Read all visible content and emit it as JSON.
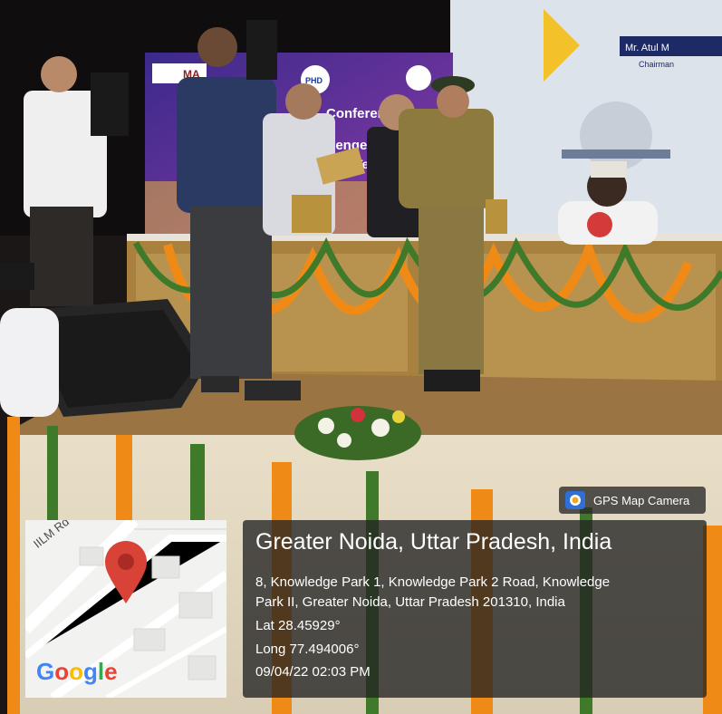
{
  "photo": {
    "backdrop_text_1": "Conference",
    "backdrop_text_2": "llenge",
    "backdrop_text_3": "M",
    "backdrop_text_4": "Tec",
    "backdrop_text_5": "PHD",
    "backdrop_text_6": "MA",
    "screen_name": "Mr. Atul M",
    "screen_role": "Chairman"
  },
  "overlay": {
    "app_badge": "GPS Map Camera",
    "map_road_label": "IILM Rd",
    "map_brand": [
      "G",
      "o",
      "o",
      "g",
      "l",
      "e"
    ],
    "map_brand_colors": [
      "#4285F4",
      "#EA4335",
      "#FBBC05",
      "#4285F4",
      "#34A853",
      "#EA4335"
    ],
    "location_title": "Greater Noida, Uttar Pradesh, India",
    "address_line_1": "8, Knowledge Park 1, Knowledge Park 2 Road, Knowledge",
    "address_line_2": "Park II, Greater Noida, Uttar Pradesh 201310, India",
    "latitude": "Lat 28.45929°",
    "longitude": "Long 77.494006°",
    "datetime": "09/04/22 02:03 PM",
    "icons": [
      "camera-icon",
      "map-pin-icon"
    ],
    "accent_pin_color": "#D94236"
  }
}
